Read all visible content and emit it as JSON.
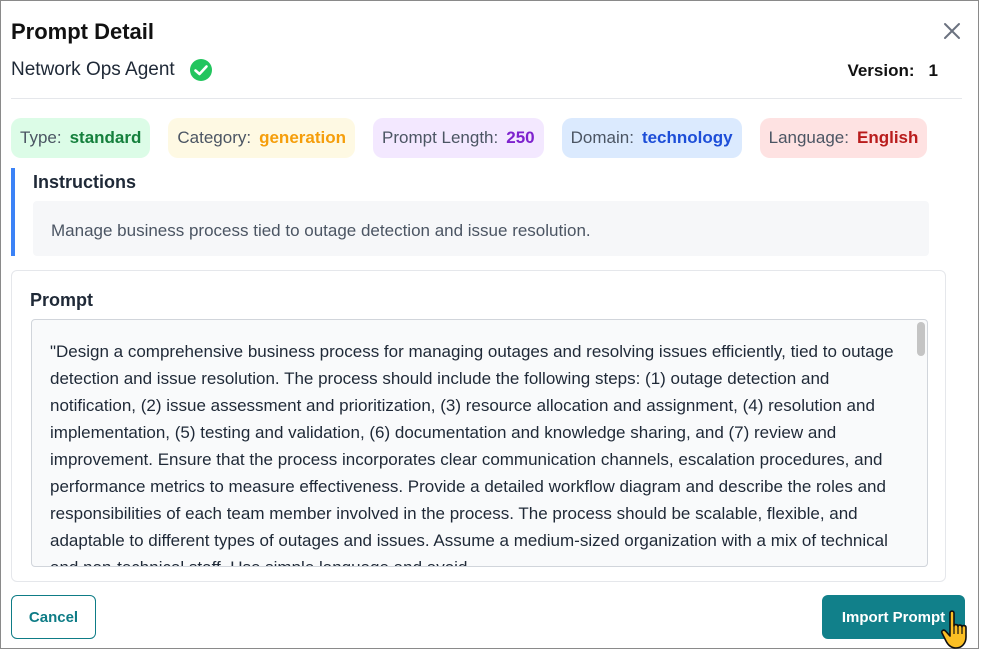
{
  "dialog": {
    "title": "Prompt Detail",
    "agent_name": "Network Ops Agent",
    "version_label": "Version:",
    "version_value": "1"
  },
  "badges": [
    {
      "label": "Type:",
      "value": "standard",
      "color": "#15803d"
    },
    {
      "label": "Category:",
      "value": "generation",
      "color": "#f59e0b"
    },
    {
      "label": "Prompt Length:",
      "value": "250",
      "color": "#7e22ce"
    },
    {
      "label": "Domain:",
      "value": "technology",
      "color": "#1d4ed8"
    },
    {
      "label": "Language:",
      "value": "English",
      "color": "#b91c1c"
    }
  ],
  "instructions": {
    "heading": "Instructions",
    "text": "Manage business process tied to outage detection and issue resolution."
  },
  "prompt": {
    "heading": "Prompt",
    "text": "\"Design a comprehensive business process for managing outages and resolving issues efficiently, tied to outage detection and issue resolution. The process should include the following steps: (1) outage detection and notification, (2) issue assessment and prioritization, (3) resource allocation and assignment, (4) resolution and implementation, (5) testing and validation, (6) documentation and knowledge sharing, and (7) review and improvement. Ensure that the process incorporates clear communication channels, escalation procedures, and performance metrics to measure effectiveness. Provide a detailed workflow diagram and describe the roles and responsibilities of each team member involved in the process. The process should be scalable, flexible, and adaptable to different types of outages and issues. Assume a medium-sized organization with a mix of technical and non-technical staff. Use simple language and avoid"
  },
  "actions": {
    "cancel_label": "Cancel",
    "import_label": "Import Prompt"
  },
  "icons": {
    "close": "close-icon",
    "verified": "check-circle-icon",
    "cursor": "hand-pointer-cursor"
  },
  "colors": {
    "accent": "#11808a",
    "instruction_bar": "#3b82f6",
    "verified": "#22c55e"
  }
}
